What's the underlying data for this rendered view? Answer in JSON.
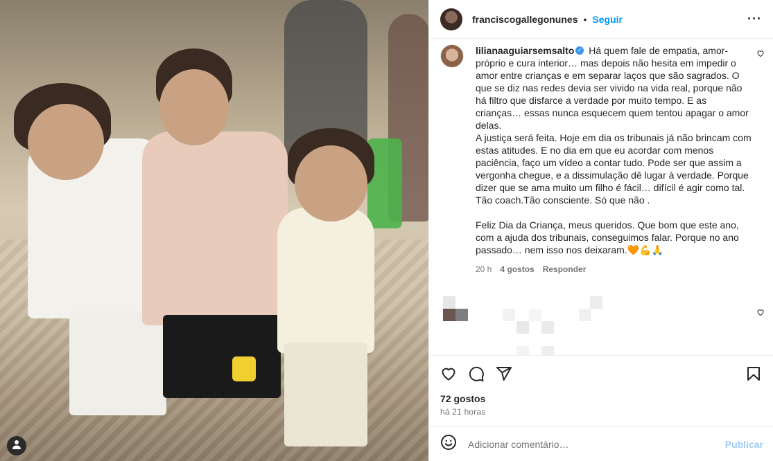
{
  "header": {
    "username": "franciscogallegonunes",
    "dot": "•",
    "follow_label": "Seguir",
    "more_label": "···"
  },
  "comment": {
    "username": "lilianaaguiarsemsalto",
    "verified": true,
    "text": "Há quem fale de empatia, amor-próprio e cura interior… mas depois não hesita em impedir o amor entre crianças e em separar laços que são sagrados. O que se diz nas redes devia ser vivido na vida real, porque não há filtro que disfarce a verdade por muito tempo. E as crianças… essas nunca esquecem quem tentou apagar o amor delas.\nA justiça será feita. Hoje em dia os tribunais já não brincam com estas atitudes. E no dia em que eu acordar com menos paciência, faço um vídeo a contar tudo. Pode ser que assim a vergonha chegue, e a dissimulação dê lugar à verdade. Porque dizer que se ama muito um filho é fácil… difícil é agir como tal.\nTão coach.Tão consciente. Só que não .\n\nFeliz Dia da Criança, meus queridos. Que bom que este ano, com a ajuda dos tribunais, conseguimos falar. Porque no ano passado… nem isso nos deixaram.🧡💪🙏",
    "time": "20 h",
    "likes": "4 gostos",
    "reply_label": "Responder"
  },
  "post": {
    "likes": "72 gostos",
    "time": "há 21 horas"
  },
  "add_comment": {
    "placeholder": "Adicionar comentário…",
    "publish_label": "Publicar"
  },
  "icons": {
    "like": "heart-icon",
    "comment": "comment-icon",
    "share": "share-icon",
    "save": "bookmark-icon",
    "emoji": "emoji-icon",
    "more": "more-icon",
    "verified": "verified-badge-icon",
    "user": "user-icon"
  },
  "colors": {
    "accent": "#0095f6",
    "publish_disabled": "#9ecbf6",
    "muted": "#737373",
    "verified": "#3897f0"
  }
}
